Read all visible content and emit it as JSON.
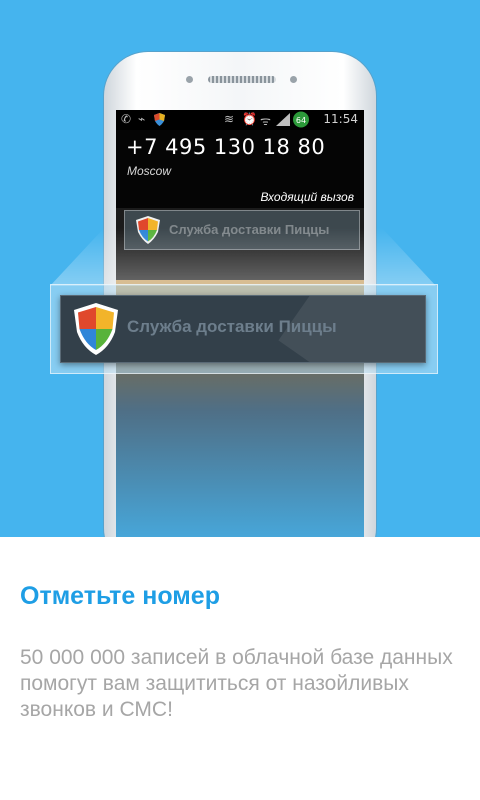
{
  "colors": {
    "hero_bg": "#45b4ee",
    "title": "#1e9ee5",
    "desc": "#a6a6a6"
  },
  "status_bar": {
    "time": "11:54",
    "battery": "64",
    "icons": [
      "phone-icon",
      "usb-icon",
      "shield-icon",
      "vibrate-icon",
      "alarm-icon",
      "wifi-icon",
      "signal-icon",
      "battery-icon"
    ]
  },
  "call": {
    "number": "+7 495 130 18 80",
    "location": "Moscow",
    "state": "Входящий вызов"
  },
  "caller_id": {
    "name": "Служба доставки Пиццы",
    "ghost_name": "Служба доставки Пиццы"
  },
  "page": {
    "title": "Отметьте номер",
    "description": "50 000 000 записей в облачной базе данных помогут вам защититься от назойливых звонков и СМС!"
  }
}
